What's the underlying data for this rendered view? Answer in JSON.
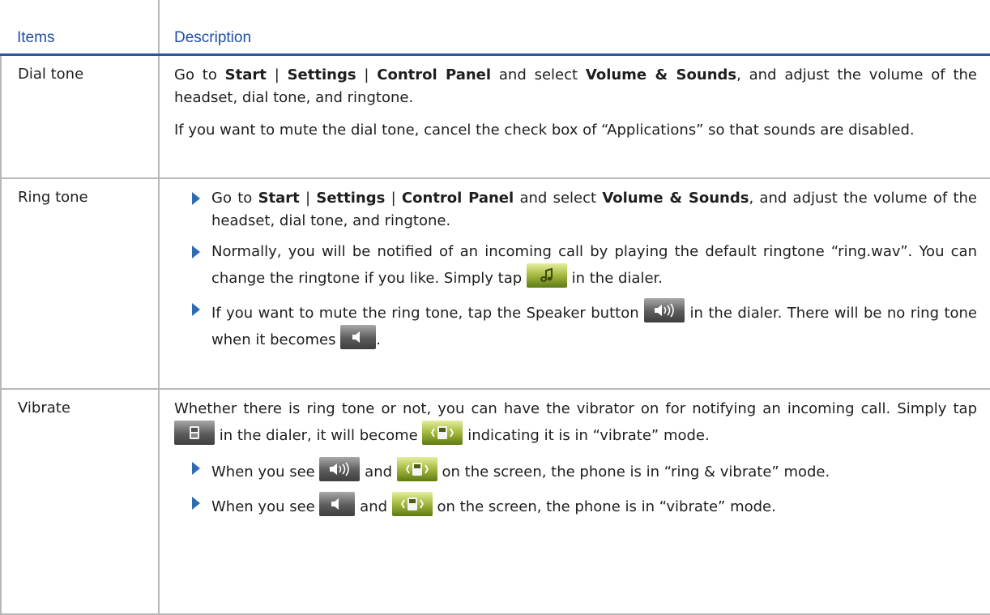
{
  "table": {
    "headers": {
      "items": "Items",
      "description": "Description"
    },
    "rows": {
      "dial_tone": {
        "item": "Dial tone",
        "p1_a": "Go to ",
        "p1_start": "Start",
        "p1_sep1": " | ",
        "p1_settings": "Settings",
        "p1_sep2": " | ",
        "p1_control": "Control Panel",
        "p1_mid": " and select ",
        "p1_volume": "Volume & Sounds",
        "p1_end": ", and adjust the volume of the headset, dial tone, and ringtone.",
        "p2": "If you want to mute the dial tone, cancel the check box of “Applications” so that sounds are disabled."
      },
      "ring_tone": {
        "item": "Ring tone",
        "b1_a": "Go to ",
        "b1_start": "Start",
        "b1_sep1": " | ",
        "b1_settings": "Settings",
        "b1_sep2": " | ",
        "b1_control": "Control Panel",
        "b1_mid": " and select ",
        "b1_volume": "Volume & Sounds",
        "b1_end": ", and adjust the volume of the headset, dial tone, and ringtone.",
        "b2_a": "Normally, you will be notified of an incoming call by playing the default ringtone “ring.wav”. You can change the ringtone if you like. Simply tap ",
        "b2_b": " in the dialer.",
        "b3_a": "If you want to mute the ring tone, tap the Speaker button ",
        "b3_b": " in the dialer. There will be no ring tone when it becomes ",
        "b3_c": "."
      },
      "vibrate": {
        "item": "Vibrate",
        "p1_a": "Whether there is ring tone or not, you can have the vibrator on for notifying an incoming call. Simply tap ",
        "p1_b": " in the dialer, it will become ",
        "p1_c": " indicating it is in “vibrate” mode.",
        "b1_a": "When you see ",
        "b1_b": " and ",
        "b1_c": " on the screen, the phone is in “ring & vibrate” mode.",
        "b2_a": "When you see ",
        "b2_b": " and ",
        "b2_c": " on the screen, the phone is in “vibrate” mode."
      }
    }
  },
  "icons": {
    "ringtone": "music-note-icon",
    "speaker_on": "speaker-on-icon",
    "speaker_muted": "speaker-muted-icon",
    "phone": "phone-icon",
    "vibrate": "vibrate-icon"
  },
  "colors": {
    "header_text": "#1f4fa3",
    "header_rule": "#2a56a8",
    "bullet": "#2d6bb2",
    "border": "#b8b8b8"
  }
}
